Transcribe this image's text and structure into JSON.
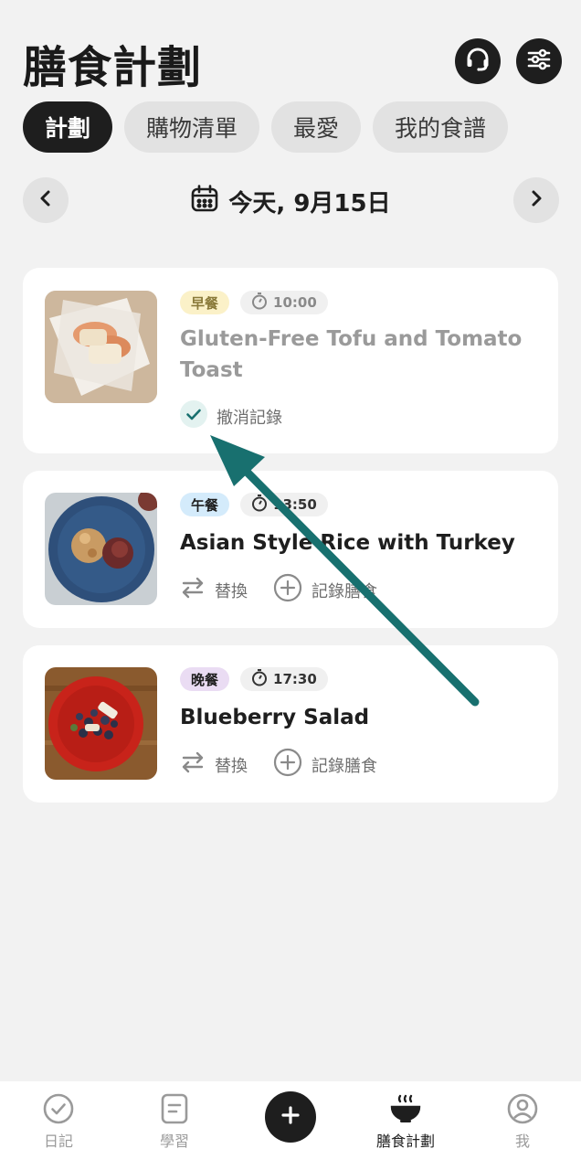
{
  "header": {
    "title": "膳食計劃"
  },
  "tabs": [
    {
      "label": "計劃",
      "active": true
    },
    {
      "label": "購物清單",
      "active": false
    },
    {
      "label": "最愛",
      "active": false
    },
    {
      "label": "我的食譜",
      "active": false
    }
  ],
  "date": {
    "label": "今天, 9月15日"
  },
  "meals": [
    {
      "type": "早餐",
      "time": "10:00",
      "title": "Gluten-Free Tofu and Tomato Toast",
      "logged": true,
      "undo_label": "撤消記錄",
      "type_color": "#fbf1c8",
      "type_text_color": "#8a7a3a"
    },
    {
      "type": "午餐",
      "time": "13:50",
      "title": "Asian Style Rice with Turkey",
      "logged": false,
      "swap_label": "替換",
      "log_label": "記錄膳食",
      "type_color": "#d4ebfb",
      "type_text_color": "#1e1e1e"
    },
    {
      "type": "晚餐",
      "time": "17:30",
      "title": "Blueberry Salad",
      "logged": false,
      "swap_label": "替換",
      "log_label": "記錄膳食",
      "type_color": "#eadcf3",
      "type_text_color": "#1e1e1e"
    }
  ],
  "tabbar": {
    "items": [
      {
        "label": "日記",
        "icon": "check-circle-icon"
      },
      {
        "label": "學習",
        "icon": "document-icon"
      },
      {
        "label": "",
        "icon": "plus-icon"
      },
      {
        "label": "膳食計劃",
        "icon": "bowl-icon",
        "active": true
      },
      {
        "label": "我",
        "icon": "profile-icon"
      }
    ]
  },
  "colors": {
    "accent": "#1e1e1e",
    "teal": "#18706f",
    "background": "#f2f2f2"
  }
}
